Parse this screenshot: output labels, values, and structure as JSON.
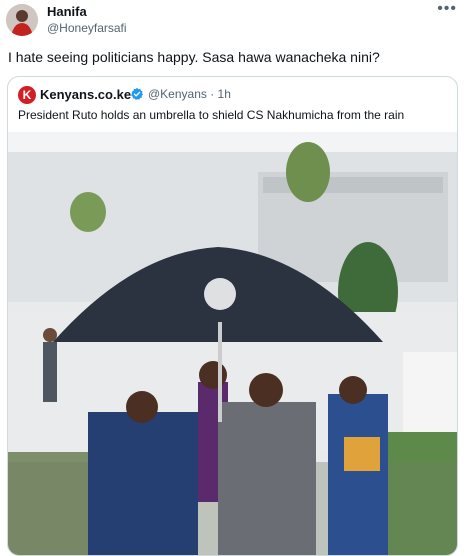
{
  "post": {
    "author_name": "Hanifa",
    "author_handle": "@Honeyfarsafi",
    "text": "I hate seeing politicians happy. Sasa hawa wanacheka nini?",
    "more_icon": "more-dots-icon",
    "more_glyph": "•••"
  },
  "quote": {
    "logo_letter": "K",
    "author_name": "Kenyans.co.ke",
    "verified_icon": "verified-badge-icon",
    "handle_time": "@Kenyans · 1h",
    "text": "President Ruto holds an umbrella to shield CS Nakhumicha from the rain",
    "photo": "photo of people walking under a black umbrella"
  },
  "colors": {
    "verified": "#1d9bf0",
    "brand_red": "#d21f26",
    "muted_text": "#536471",
    "border": "#cfd9de"
  }
}
